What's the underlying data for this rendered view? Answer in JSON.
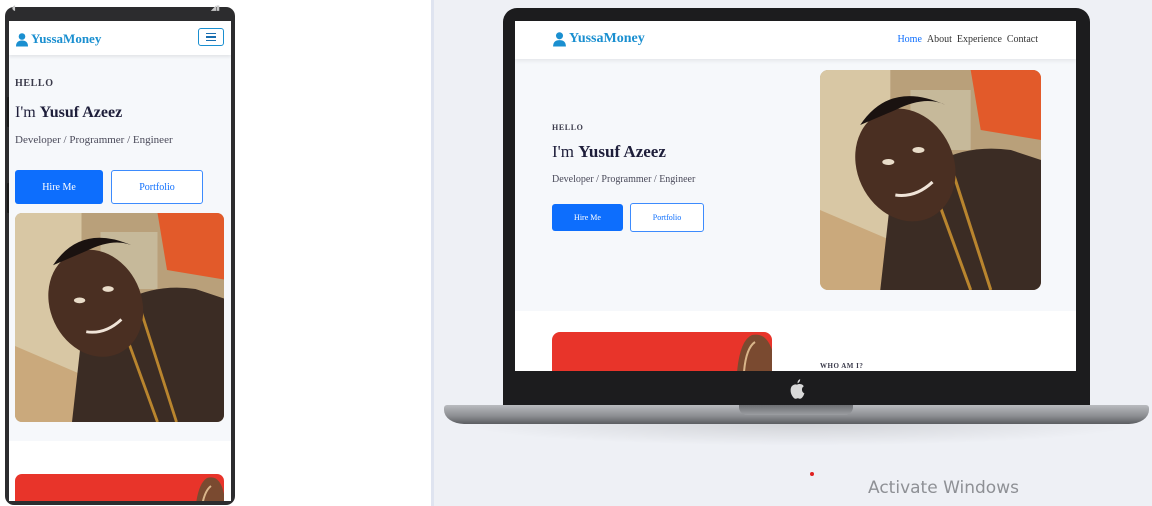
{
  "brand": {
    "name": "YussaMoney",
    "color": "#1a8fd0"
  },
  "hero": {
    "greeting": "HELLO",
    "intro_prefix": "I'm ",
    "name": "Yusuf Azeez",
    "tagline": "Developer / Programmer / Engineer",
    "hire_label": "Hire Me",
    "portfolio_label": "Portfolio"
  },
  "desktop_nav": {
    "items": [
      {
        "label": "Home",
        "active": true
      },
      {
        "label": "About",
        "active": false
      },
      {
        "label": "Experience",
        "active": false
      },
      {
        "label": "Contact",
        "active": false
      }
    ]
  },
  "about": {
    "heading": "WHO AM I?"
  },
  "overlay": {
    "watermark": "Activate Windows"
  },
  "colors": {
    "primary": "#0d6efd",
    "hero_bg": "#f6f8fb",
    "page_bg": "#eef0f5"
  },
  "icons": [
    "brand-user-icon",
    "hamburger-icon",
    "apple-logo-icon"
  ]
}
